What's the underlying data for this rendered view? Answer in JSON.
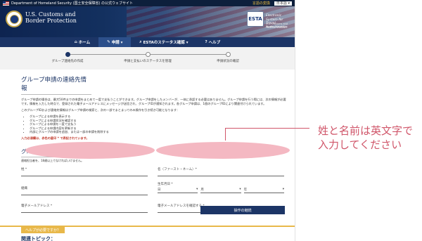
{
  "topbar": {
    "agency_note": "Department of Homeland Security (国土安全保障省) の公式ウェブサイト",
    "language_link": "言語の変換",
    "language_select": "日本語 ▾"
  },
  "header": {
    "agency_line1": "U.S. Customs and",
    "agency_line2": "Border Protection",
    "esta_logo": "ESTA",
    "esta_line1": "Electronic System for",
    "esta_line2": "Travel Authorization",
    "esta_sub": "U.S. Customs and Border Protection"
  },
  "nav": {
    "items": [
      {
        "icon": "home-icon",
        "glyph": "⌂",
        "label": "ホーム"
      },
      {
        "icon": "apply-icon",
        "glyph": "✎",
        "label": "申請 ▾"
      },
      {
        "icon": "search-icon",
        "glyph": "⌕",
        "label": "ESTAのステータス確認 ▾"
      },
      {
        "icon": "help-icon",
        "glyph": "?",
        "label": "ヘルプ"
      }
    ],
    "active_index": 1
  },
  "progress": {
    "steps": [
      {
        "label": "グループ連絡先の作成"
      },
      {
        "label": "申請と支払いのステータスを管理"
      },
      {
        "label": "申請状況の確認"
      }
    ],
    "current_step": 1
  },
  "main": {
    "title": "グループ申請の連絡先情報",
    "description": "グループ申請の場合は、最大50件までの申請をまとめて一度で支払うことができます。グループ申請をしたメンバーが、一体に承認する必要はありません。グループ申請を行う際には、次の情報が必要です。情報を入力した時点で、登録された電子メールアドレスにメッセージが送信され、グループIDが通知されます。各グループ申請は、1個のグループIDにより関連付けられています。",
    "description2": "このグループIDおよび連絡先情報はグループ申請の検索と、次の一部でまとまってのみ操作を引き続き可能となります：",
    "actions": [
      "グループによる申請を表示する",
      "グループによる申請状況を確認する",
      "グループによる申請を一度で支払う",
      "グループによる申請内容を更新する",
      "内部にグループの申請を追加、またはー部の申請を削除する"
    ],
    "required_note": "入力必須欄は、赤色の星印 * で表記されています。"
  },
  "contact_form": {
    "section_title": "グループ申請の連絡担当者",
    "section_subtitle": "連絡担当者を、18歳以上でなければいけません。",
    "surname_label": "姓 *",
    "given_name_label": "名（ファースト・ネーム）*",
    "org_label": "組織",
    "dob_label": "生年月日 *",
    "dob_day": "日",
    "dob_month": "月",
    "dob_year": "年",
    "email_label": "電子メールアドレス *",
    "email_confirm_label": "電子メールアドレスを確認する *",
    "submit_label": "操作の継続"
  },
  "help_footer": {
    "tab_label": "ヘルプが必要ですか？",
    "topics_title": "関連トピック："
  },
  "annotation": {
    "line1": "姓と名前は英文字で",
    "line2": "入力してください"
  },
  "colors": {
    "navy": "#1c3566",
    "accent_gold": "#e8b84a",
    "annotation": "#d0566a",
    "redaction": "#f4b8c2"
  }
}
